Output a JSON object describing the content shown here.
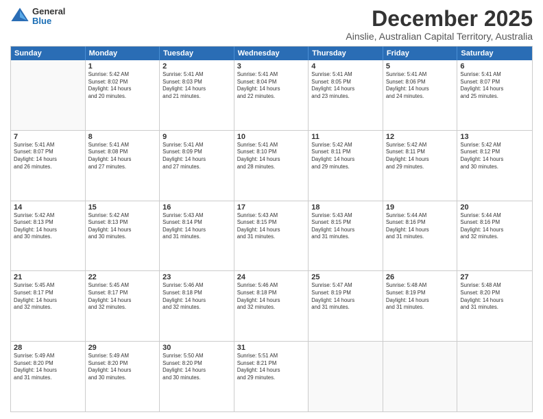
{
  "logo": {
    "general": "General",
    "blue": "Blue"
  },
  "title": "December 2025",
  "location": "Ainslie, Australian Capital Territory, Australia",
  "header_days": [
    "Sunday",
    "Monday",
    "Tuesday",
    "Wednesday",
    "Thursday",
    "Friday",
    "Saturday"
  ],
  "weeks": [
    [
      {
        "day": "",
        "info": ""
      },
      {
        "day": "1",
        "info": "Sunrise: 5:42 AM\nSunset: 8:02 PM\nDaylight: 14 hours\nand 20 minutes."
      },
      {
        "day": "2",
        "info": "Sunrise: 5:41 AM\nSunset: 8:03 PM\nDaylight: 14 hours\nand 21 minutes."
      },
      {
        "day": "3",
        "info": "Sunrise: 5:41 AM\nSunset: 8:04 PM\nDaylight: 14 hours\nand 22 minutes."
      },
      {
        "day": "4",
        "info": "Sunrise: 5:41 AM\nSunset: 8:05 PM\nDaylight: 14 hours\nand 23 minutes."
      },
      {
        "day": "5",
        "info": "Sunrise: 5:41 AM\nSunset: 8:06 PM\nDaylight: 14 hours\nand 24 minutes."
      },
      {
        "day": "6",
        "info": "Sunrise: 5:41 AM\nSunset: 8:07 PM\nDaylight: 14 hours\nand 25 minutes."
      }
    ],
    [
      {
        "day": "7",
        "info": "Sunrise: 5:41 AM\nSunset: 8:07 PM\nDaylight: 14 hours\nand 26 minutes."
      },
      {
        "day": "8",
        "info": "Sunrise: 5:41 AM\nSunset: 8:08 PM\nDaylight: 14 hours\nand 27 minutes."
      },
      {
        "day": "9",
        "info": "Sunrise: 5:41 AM\nSunset: 8:09 PM\nDaylight: 14 hours\nand 27 minutes."
      },
      {
        "day": "10",
        "info": "Sunrise: 5:41 AM\nSunset: 8:10 PM\nDaylight: 14 hours\nand 28 minutes."
      },
      {
        "day": "11",
        "info": "Sunrise: 5:42 AM\nSunset: 8:11 PM\nDaylight: 14 hours\nand 29 minutes."
      },
      {
        "day": "12",
        "info": "Sunrise: 5:42 AM\nSunset: 8:11 PM\nDaylight: 14 hours\nand 29 minutes."
      },
      {
        "day": "13",
        "info": "Sunrise: 5:42 AM\nSunset: 8:12 PM\nDaylight: 14 hours\nand 30 minutes."
      }
    ],
    [
      {
        "day": "14",
        "info": "Sunrise: 5:42 AM\nSunset: 8:13 PM\nDaylight: 14 hours\nand 30 minutes."
      },
      {
        "day": "15",
        "info": "Sunrise: 5:42 AM\nSunset: 8:13 PM\nDaylight: 14 hours\nand 30 minutes."
      },
      {
        "day": "16",
        "info": "Sunrise: 5:43 AM\nSunset: 8:14 PM\nDaylight: 14 hours\nand 31 minutes."
      },
      {
        "day": "17",
        "info": "Sunrise: 5:43 AM\nSunset: 8:15 PM\nDaylight: 14 hours\nand 31 minutes."
      },
      {
        "day": "18",
        "info": "Sunrise: 5:43 AM\nSunset: 8:15 PM\nDaylight: 14 hours\nand 31 minutes."
      },
      {
        "day": "19",
        "info": "Sunrise: 5:44 AM\nSunset: 8:16 PM\nDaylight: 14 hours\nand 31 minutes."
      },
      {
        "day": "20",
        "info": "Sunrise: 5:44 AM\nSunset: 8:16 PM\nDaylight: 14 hours\nand 32 minutes."
      }
    ],
    [
      {
        "day": "21",
        "info": "Sunrise: 5:45 AM\nSunset: 8:17 PM\nDaylight: 14 hours\nand 32 minutes."
      },
      {
        "day": "22",
        "info": "Sunrise: 5:45 AM\nSunset: 8:17 PM\nDaylight: 14 hours\nand 32 minutes."
      },
      {
        "day": "23",
        "info": "Sunrise: 5:46 AM\nSunset: 8:18 PM\nDaylight: 14 hours\nand 32 minutes."
      },
      {
        "day": "24",
        "info": "Sunrise: 5:46 AM\nSunset: 8:18 PM\nDaylight: 14 hours\nand 32 minutes."
      },
      {
        "day": "25",
        "info": "Sunrise: 5:47 AM\nSunset: 8:19 PM\nDaylight: 14 hours\nand 31 minutes."
      },
      {
        "day": "26",
        "info": "Sunrise: 5:48 AM\nSunset: 8:19 PM\nDaylight: 14 hours\nand 31 minutes."
      },
      {
        "day": "27",
        "info": "Sunrise: 5:48 AM\nSunset: 8:20 PM\nDaylight: 14 hours\nand 31 minutes."
      }
    ],
    [
      {
        "day": "28",
        "info": "Sunrise: 5:49 AM\nSunset: 8:20 PM\nDaylight: 14 hours\nand 31 minutes."
      },
      {
        "day": "29",
        "info": "Sunrise: 5:49 AM\nSunset: 8:20 PM\nDaylight: 14 hours\nand 30 minutes."
      },
      {
        "day": "30",
        "info": "Sunrise: 5:50 AM\nSunset: 8:20 PM\nDaylight: 14 hours\nand 30 minutes."
      },
      {
        "day": "31",
        "info": "Sunrise: 5:51 AM\nSunset: 8:21 PM\nDaylight: 14 hours\nand 29 minutes."
      },
      {
        "day": "",
        "info": ""
      },
      {
        "day": "",
        "info": ""
      },
      {
        "day": "",
        "info": ""
      }
    ]
  ]
}
